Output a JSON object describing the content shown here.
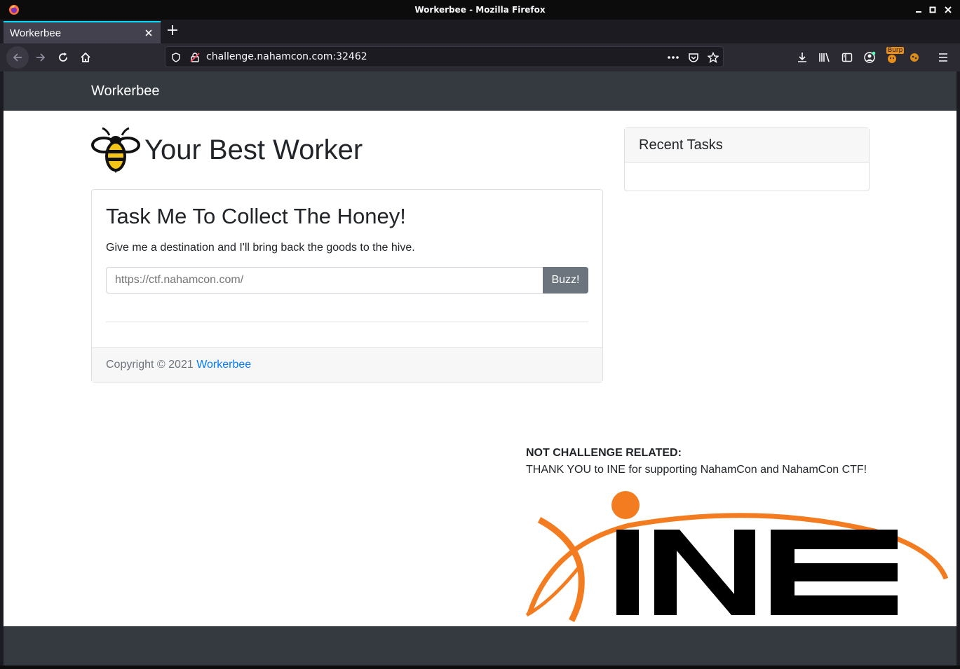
{
  "window": {
    "title": "Workerbee - Mozilla Firefox"
  },
  "tab": {
    "title": "Workerbee"
  },
  "urlbar": {
    "url": "challenge.nahamcon.com:32462"
  },
  "toolbar": {
    "burp_badge": "Burp"
  },
  "site": {
    "brand": "Workerbee",
    "hero_title": "Your Best Worker",
    "card": {
      "title": "Task Me To Collect The Honey!",
      "text": "Give me a destination and I'll bring back the goods to the hive.",
      "input_placeholder": "https://ctf.nahamcon.com/",
      "button_label": "Buzz!",
      "copyright_prefix": "Copyright © 2021",
      "copyright_link": "Workerbee"
    },
    "sidebar": {
      "title": "Recent Tasks"
    },
    "sponsor": {
      "header": "NOT CHALLENGE RELATED:",
      "text": "THANK YOU to INE for supporting NahamCon and NahamCon CTF!",
      "logo_text": "INE"
    }
  },
  "colors": {
    "navbar": "#343a40",
    "button": "#6c757d",
    "link": "#007bff",
    "ine_orange": "#f47c20",
    "bee_yellow": "#f5c518"
  }
}
